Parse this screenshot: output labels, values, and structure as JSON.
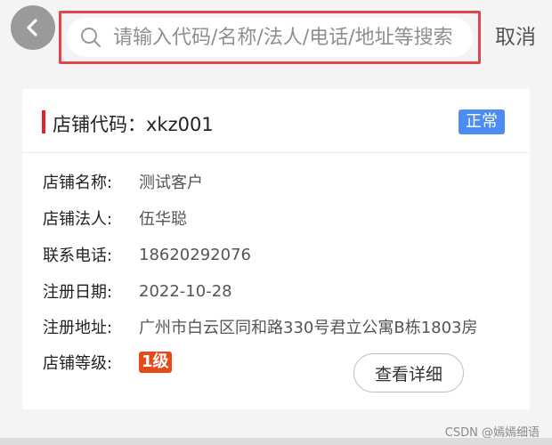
{
  "header": {
    "back_icon": "chevron-left-icon",
    "search_icon": "search-icon",
    "search_placeholder": "请输入代码/名称/法人/电话/地址等搜索",
    "search_value": "",
    "cancel_label": "取消"
  },
  "card": {
    "code_label": "店铺代码：xkz001",
    "status": "正常",
    "rows": [
      {
        "label": "店铺名称:",
        "value": "测试客户"
      },
      {
        "label": "店铺法人:",
        "value": "伍华聪"
      },
      {
        "label": "联系电话:",
        "value": "18620292076"
      },
      {
        "label": "注册日期:",
        "value": "2022-10-28"
      },
      {
        "label": "注册地址:",
        "value": "广州市白云区同和路330号君立公寓B栋1803房"
      },
      {
        "label": "店铺等级:",
        "value": "1级"
      }
    ],
    "detail_button": "查看详细"
  },
  "watermark": "CSDN @嫣嫣细语",
  "colors": {
    "accent_red": "#e3232b",
    "highlight_outline": "#e0474c",
    "status_blue": "#4c8cf5",
    "level_orange": "#e64a19"
  }
}
